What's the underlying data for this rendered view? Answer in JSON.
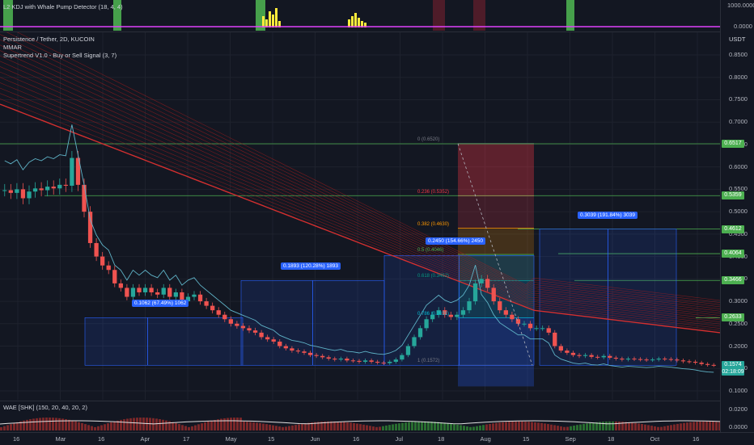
{
  "indicators": {
    "kdj_title": "L2 KDJ with Whale Pump Detector (18, 4, 4)",
    "symbol_title": "Persistence / Tether, 2D, KUCOIN",
    "mmar_title": "MMAR",
    "supertrend_title": "Supertrend V1.0 - Buy or Sell Signal (3, 7)",
    "wae_title": "WAE [SHK] (150, 20, 40, 20, 2)"
  },
  "price_scale": {
    "currency": "USDT",
    "kdj_top": "1000.0000",
    "kdj_bottom": "0.0000",
    "ticks": [
      "0.8500",
      "0.8000",
      "0.7500",
      "0.7000",
      "0.6500",
      "0.6000",
      "0.5500",
      "0.5000",
      "0.4500",
      "0.4000",
      "0.3500",
      "0.3000",
      "0.2500",
      "0.2000",
      "0.1500",
      "0.1000"
    ],
    "wae_top": "0.0200",
    "wae_bottom": "0.0000",
    "current_price": "0.1574",
    "countdown": "02:18:09"
  },
  "price_tags": [
    {
      "text": "0.6517",
      "value": 0.6517,
      "color": "#4caf50"
    },
    {
      "text": "0.5359",
      "value": 0.5359,
      "color": "#4caf50"
    },
    {
      "text": "0.4612",
      "value": 0.4612,
      "color": "#4caf50"
    },
    {
      "text": "0.4064",
      "value": 0.4064,
      "color": "#4caf50"
    },
    {
      "text": "0.3466",
      "value": 0.3466,
      "color": "#4caf50"
    },
    {
      "text": "0.2633",
      "value": 0.2633,
      "color": "#4caf50"
    }
  ],
  "fib_levels": [
    {
      "text": "0 (0.6520)",
      "value": 0.652,
      "color": "#787b86"
    },
    {
      "text": "0.236 (0.5352)",
      "value": 0.5352,
      "color": "#f23645"
    },
    {
      "text": "0.382 (0.4630)",
      "value": 0.463,
      "color": "#ff9800"
    },
    {
      "text": "0.5 (0.4046)",
      "value": 0.4046,
      "color": "#4caf50"
    },
    {
      "text": "0.618 (0.3462)",
      "value": 0.3462,
      "color": "#089981"
    },
    {
      "text": "0.786 (0.2631)",
      "value": 0.2631,
      "color": "#00bcd4"
    },
    {
      "text": "1 (0.1572)",
      "value": 0.1572,
      "color": "#787b86"
    }
  ],
  "measure_boxes": [
    {
      "text": "0.1062 (67.49%) 1062",
      "from": 0.1572,
      "to": 0.2634
    },
    {
      "text": "0.1893 (120.28%) 1893",
      "from": 0.1572,
      "to": 0.3465
    },
    {
      "text": "0.2450 (154.66%) 2450",
      "from": 0.1572,
      "to": 0.4022
    },
    {
      "text": "0.3039 (191.84%) 3039",
      "from": 0.1572,
      "to": 0.4611
    }
  ],
  "time_axis": [
    "16",
    "Mar",
    "16",
    "Apr",
    "17",
    "May",
    "15",
    "Jun",
    "16",
    "Jul",
    "18",
    "Aug",
    "15",
    "Sep",
    "18",
    "Oct",
    "16"
  ],
  "chart_data": {
    "type": "candlestick",
    "title": "Persistence / Tether, 2D, KUCOIN",
    "ylim": [
      0.05,
      0.87
    ],
    "y_scale": "linear",
    "grid": true,
    "up_color": "#26a69a",
    "down_color": "#ef5350",
    "close_series": [
      0.548,
      0.542,
      0.55,
      0.53,
      0.545,
      0.552,
      0.548,
      0.556,
      0.552,
      0.56,
      0.558,
      0.62,
      0.56,
      0.5,
      0.43,
      0.4,
      0.38,
      0.37,
      0.34,
      0.33,
      0.31,
      0.33,
      0.32,
      0.33,
      0.32,
      0.315,
      0.33,
      0.31,
      0.32,
      0.3,
      0.31,
      0.315,
      0.3,
      0.29,
      0.28,
      0.27,
      0.26,
      0.25,
      0.245,
      0.24,
      0.235,
      0.23,
      0.22,
      0.215,
      0.21,
      0.2,
      0.195,
      0.19,
      0.188,
      0.185,
      0.18,
      0.178,
      0.175,
      0.172,
      0.17,
      0.172,
      0.168,
      0.167,
      0.165,
      0.168,
      0.165,
      0.163,
      0.162,
      0.165,
      0.17,
      0.18,
      0.2,
      0.22,
      0.24,
      0.26,
      0.27,
      0.28,
      0.27,
      0.265,
      0.27,
      0.28,
      0.3,
      0.34,
      0.35,
      0.33,
      0.3,
      0.28,
      0.27,
      0.26,
      0.25,
      0.25,
      0.24,
      0.24,
      0.24,
      0.23,
      0.2,
      0.19,
      0.185,
      0.18,
      0.178,
      0.18,
      0.176,
      0.175,
      0.178,
      0.174,
      0.172,
      0.17,
      0.172,
      0.171,
      0.17,
      0.169,
      0.17,
      0.172,
      0.171,
      0.17,
      0.168,
      0.166,
      0.165,
      0.163,
      0.16,
      0.158,
      0.1574
    ],
    "overlays": [
      "MMAR ribbon",
      "Supertrend"
    ],
    "sub_indicators": [
      "L2 KDJ with Whale Pump Detector",
      "WAE [SHK]"
    ]
  }
}
